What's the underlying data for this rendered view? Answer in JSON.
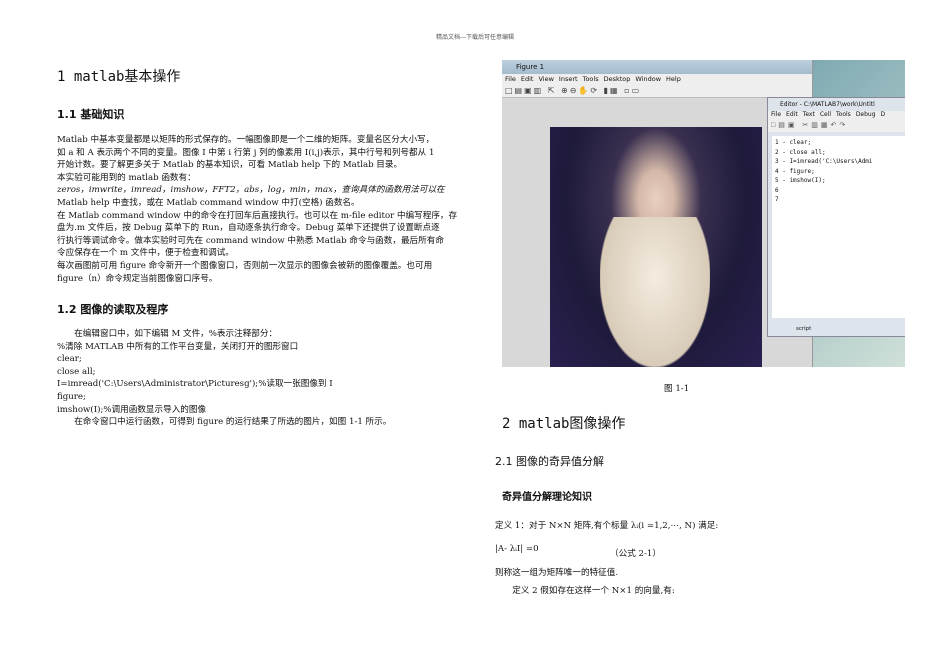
{
  "header": "精品文档---下载后可任意编辑",
  "left": {
    "title": "1 matlab基本操作",
    "s11": "1.1 基础知识",
    "p1": [
      "Matlab 中基本变量都是以矩阵的形式保存的。一幅图像即是一个二维的矩阵。变量名区分大小写，",
      "如 a 和 A 表示两个不同的变量。图像 I 中第 i 行第 j 列的像素用 I(i,j)表示，其中行号和列号都从 1",
      "开始计数。要了解更多关于 Matlab 的基本知识，可看 Matlab help 下的 Matlab 目录。",
      "本实验可能用到的 matlab 函数有：",
      "zeros，imwrite，imread，imshow，FFT2，abs，log，min，max，查询具体的函数用法可以在",
      "Matlab help 中查找，或在 Matlab command window 中打(空格) 函数名。",
      "在 Matlab command window 中的命令在打回车后直接执行。也可以在 m-file editor 中编写程序，存",
      "盘为.m 文件后，按 Debug 菜单下的 Run，自动逐条执行命令。Debug 菜单下还提供了设置断点逐",
      "行执行等调试命令。做本实验时可先在 command window 中熟悉 Matlab 命令与函数，最后所有命",
      "令应保存在一个 m 文件中，便于检查和调试。",
      "每次画图前可用 figure 命令新开一个图像窗口，否则前一次显示的图像会被新的图像覆盖。也可用",
      "figure（n）命令规定当前图像窗口序号。"
    ],
    "s12": "1.2 图像的读取及程序",
    "p2": [
      "　　在编辑窗口中，如下编辑 M 文件，%表示注释部分：",
      "%清除 MATLAB 中所有的工作平台变量，关闭打开的图形窗口",
      "clear;",
      "close all;",
      "I=imread('C:\\Users\\Administrator\\Picturesg');%读取一张图像到 I",
      "figure;",
      "imshow(I);%调用函数显示导入的图像",
      "　　在命令窗口中运行函数，可得到 figure 的运行结果了所选的图片，如图 1-1 所示。"
    ]
  },
  "figure": {
    "window_title": "Figure 1",
    "menu": [
      "File",
      "Edit",
      "View",
      "Insert",
      "Tools",
      "Desktop",
      "Window",
      "Help"
    ],
    "editor_title": "Editor - C:\\MATLAB7\\work\\Untitl",
    "editor_menu": [
      "File",
      "Edit",
      "Text",
      "Cell",
      "Tools",
      "Debug",
      "D"
    ],
    "code": [
      "1 -  clear;",
      "2 -  close all;",
      "3 -  I=imread('C:\\Users\\Admi",
      "4 -  figure;",
      "5 -  imshow(I);",
      "6",
      "7"
    ],
    "status": "script",
    "caption": "图 1-1"
  },
  "right": {
    "title": "2 matlab图像操作",
    "s21": "2.1 图像的奇异值分解",
    "s211": "奇异值分解理论知识",
    "def1": "定义 1：对于 N×N 矩阵,有个标量 λᵢ(i =1,2,⋯, N) 满足:",
    "eq": "|A- λᵢI| =0",
    "eqlabel": "（公式 2-1）",
    "line3": "则称这一组为矩阵唯一的特征值.",
    "def2": "　　定义 2 假如存在这样一个 N×1 的向量,有:"
  }
}
